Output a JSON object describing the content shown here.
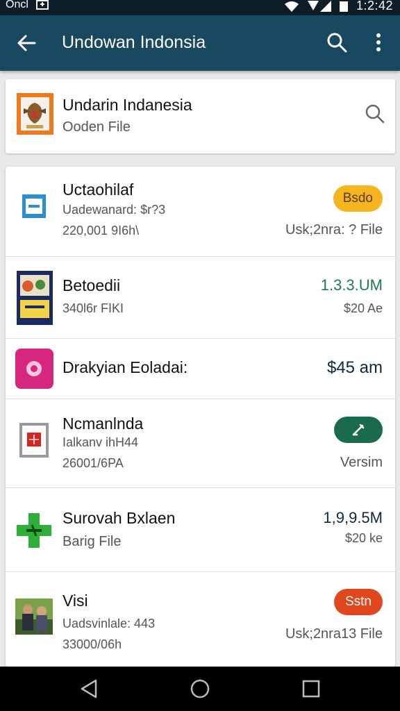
{
  "status_bar": {
    "carrier": "Oncl",
    "time": "1:2:42",
    "icons": [
      "notification-icon",
      "wifi-icon",
      "signal-icon",
      "battery-icon"
    ]
  },
  "app_bar": {
    "title": "Undowan Indonsia",
    "icons": [
      "back-arrow-icon",
      "search-icon",
      "more-vert-icon"
    ]
  },
  "header": {
    "title": "Undarin Indanesia",
    "subtitle": "Ooden File",
    "icons": [
      "emblem-icon",
      "search-icon"
    ]
  },
  "items": [
    {
      "title": "Uctaohilaf",
      "line2": "Uadewanard: $r?3",
      "line3": "220,001 9I6h\\",
      "right_line2": "Usk;2nra: ? File",
      "badge": "Bsdo",
      "badge_color": "#f6b51e",
      "badge_text_color": "#5a3a00",
      "icon": "window-frame-icon"
    },
    {
      "title": "Betoedii",
      "line2": "340l6r FIKI",
      "right_line1": "1.3.3.UM",
      "right_line1_color": "#1f7a4f",
      "right_line2": "$20 Ae",
      "icon": "boxart-icon"
    },
    {
      "title": "Drakyian Eoladai:",
      "right_line1": "$45 am",
      "right_line1_color": "#0e2a3a",
      "icon": "pink-app-icon"
    },
    {
      "title": "Ncmanlnda",
      "line2": "Ialkanv ihH44",
      "line3": "26001/6PA",
      "right_line2": "Versim",
      "badge": "edit-icon",
      "badge_color": "#1a6a4c",
      "icon": "red-square-icon"
    },
    {
      "title": "Surovah Bxlaen",
      "line2": "Barig File",
      "right_line1": "1,9,9.5M",
      "right_line1_color": "#0e2a3a",
      "right_line2": "$20 ke",
      "icon": "green-app-icon"
    },
    {
      "title": "Visi",
      "line2": "Uadsvinlale: 443",
      "line3": "33000/06h",
      "right_line2": "Usk;2nra13 File",
      "badge": "Sstn",
      "badge_color": "#e1471f",
      "badge_text_color": "#ffffff",
      "icon": "photo-thumbnail-icon"
    }
  ],
  "nav_bar": {
    "icons": [
      "back-triangle-icon",
      "home-circle-icon",
      "recents-square-icon"
    ]
  }
}
